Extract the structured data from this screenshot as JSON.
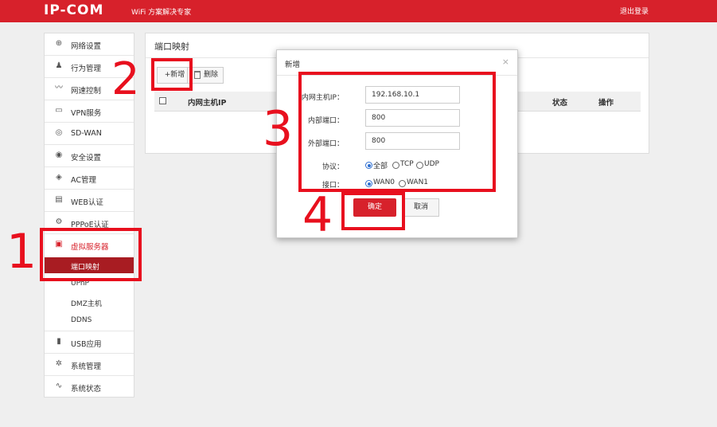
{
  "header": {
    "logo": "IP-COM",
    "slogan": "WiFi 方案解决专家",
    "logout": "退出登录"
  },
  "sidebar": {
    "items": [
      {
        "label": "网络设置",
        "icon": "globe-icon",
        "glyph": "⊕"
      },
      {
        "label": "行为管理",
        "icon": "user-icon",
        "glyph": "♟"
      },
      {
        "label": "网速控制",
        "icon": "speed-icon",
        "glyph": "〰"
      },
      {
        "label": "VPN服务",
        "icon": "monitor-icon",
        "glyph": "▭"
      },
      {
        "label": "SD-WAN",
        "icon": "network-icon",
        "glyph": "◎"
      },
      {
        "label": "安全设置",
        "icon": "shield-icon",
        "glyph": "◉"
      },
      {
        "label": "AC管理",
        "icon": "ac-icon",
        "glyph": "◈"
      },
      {
        "label": "WEB认证",
        "icon": "web-auth-icon",
        "glyph": "▤"
      },
      {
        "label": "PPPoE认证",
        "icon": "pppoe-icon",
        "glyph": "⚙"
      },
      {
        "label": "虚拟服务器",
        "icon": "server-icon",
        "glyph": "▣"
      }
    ],
    "sub_items": [
      "端口映射",
      "UPnP",
      "DMZ主机",
      "DDNS"
    ],
    "bottom_items": [
      {
        "label": "USB应用",
        "icon": "usb-icon",
        "glyph": "▮"
      },
      {
        "label": "系统管理",
        "icon": "gear-icon",
        "glyph": "✲"
      },
      {
        "label": "系统状态",
        "icon": "pulse-icon",
        "glyph": "∿"
      }
    ]
  },
  "panel": {
    "title": "端口映射",
    "add_label": "+新增",
    "delete_label": "删除",
    "columns": [
      "内网主机IP",
      "状态",
      "操作"
    ]
  },
  "modal": {
    "title": "新增",
    "close": "×",
    "fields": {
      "ip_label": "内网主机IP：",
      "ip_value": "192.168.10.1",
      "inner_port_label": "内部端口：",
      "inner_port_value": "800",
      "outer_port_label": "外部端口：",
      "outer_port_value": "800",
      "protocol_label": "协议：",
      "protocol_options": [
        "全部",
        "TCP",
        "UDP"
      ],
      "protocol_selected": "全部",
      "iface_label": "接口：",
      "iface_options": [
        "WAN0",
        "WAN1"
      ],
      "iface_selected": "WAN0"
    },
    "ok_label": "确定",
    "cancel_label": "取消"
  },
  "annotations": {
    "n1": "1",
    "n2": "2",
    "n3": "3",
    "n4": "4"
  },
  "colors": {
    "brand_red": "#d7212b",
    "annotation_red": "#e8101e",
    "active_submenu": "#a81c22"
  }
}
